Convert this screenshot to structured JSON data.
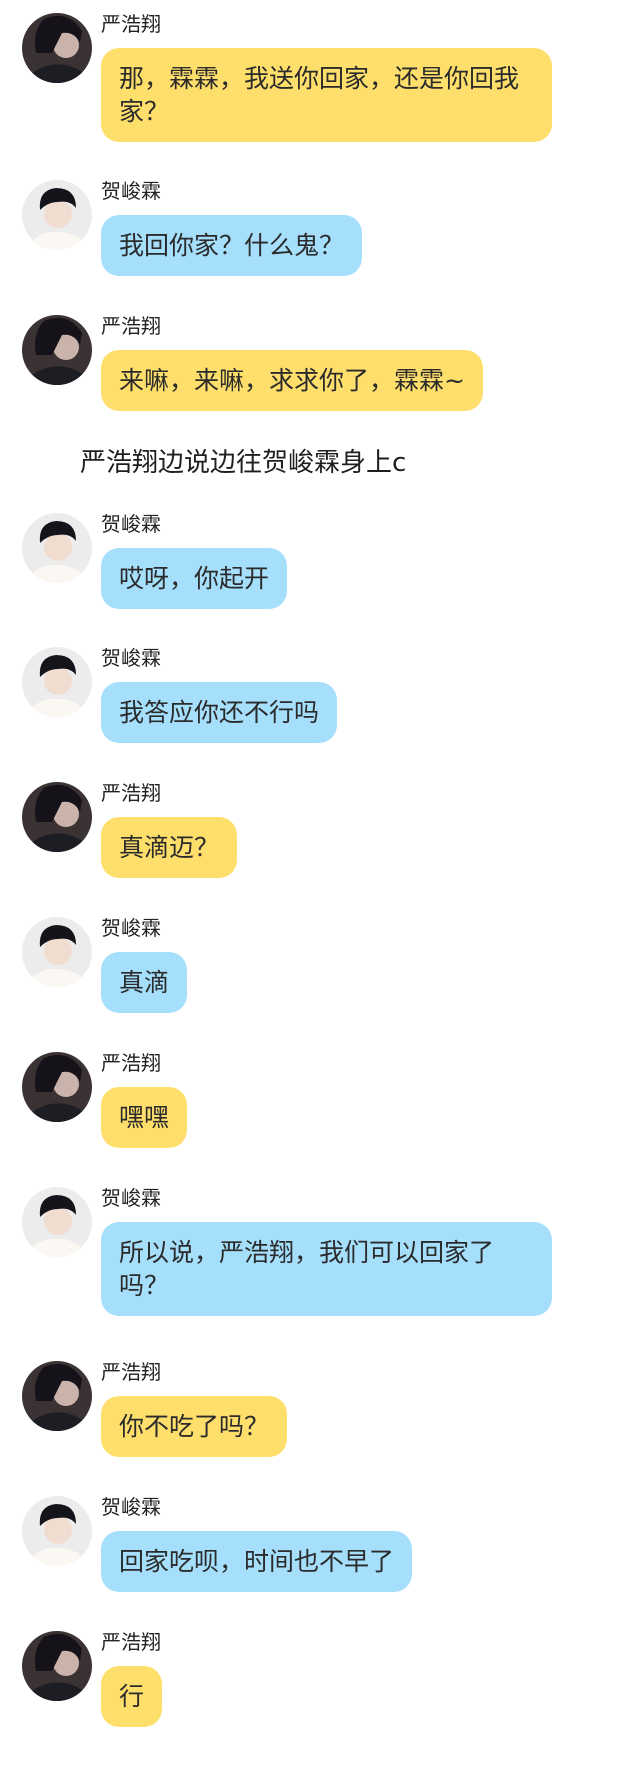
{
  "participants": {
    "yan": {
      "name": "严浩翔",
      "avatar_icon": "dark-hair-profile-avatar",
      "bubble_color": "#ffdf6c"
    },
    "he": {
      "name": "贺峻霖",
      "avatar_icon": "light-sweater-avatar",
      "bubble_color": "#a5dffc"
    }
  },
  "messages": [
    {
      "sender": "严浩翔",
      "text": "那，霖霖，我送你回家，还是你回我家？"
    },
    {
      "sender": "贺峻霖",
      "text": "我回你家？什么鬼？"
    },
    {
      "sender": "严浩翔",
      "text": "来嘛，来嘛，求求你了，霖霖~"
    },
    {
      "sender": "贺峻霖",
      "text": "哎呀，你起开"
    },
    {
      "sender": "贺峻霖",
      "text": "我答应你还不行吗"
    },
    {
      "sender": "严浩翔",
      "text": "真滴迈？"
    },
    {
      "sender": "贺峻霖",
      "text": "真滴"
    },
    {
      "sender": "严浩翔",
      "text": "嘿嘿"
    },
    {
      "sender": "贺峻霖",
      "text": "所以说，严浩翔，我们可以回家了吗？"
    },
    {
      "sender": "严浩翔",
      "text": "你不吃了吗？"
    },
    {
      "sender": "贺峻霖",
      "text": "回家吃呗，时间也不早了"
    },
    {
      "sender": "严浩翔",
      "text": "行"
    }
  ],
  "narration": "严浩翔边说边往贺峻霖身上c"
}
